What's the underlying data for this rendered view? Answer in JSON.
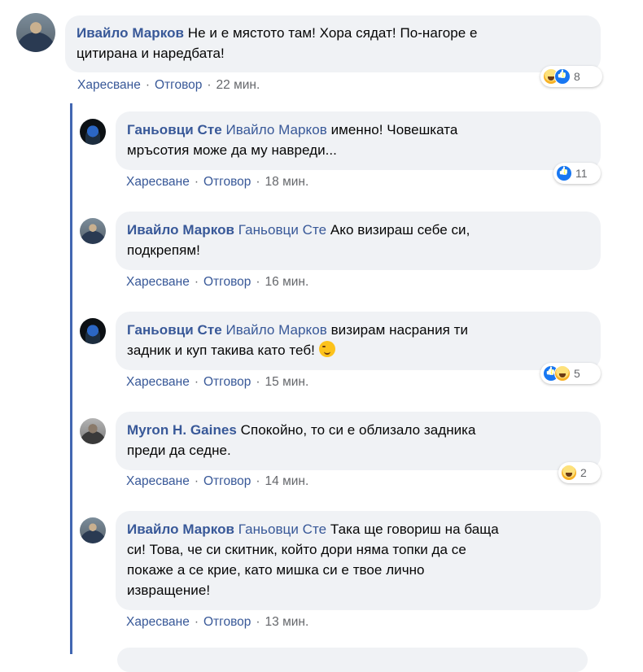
{
  "actions": {
    "like": "Харесване",
    "reply": "Отговор"
  },
  "comments": [
    {
      "author": "Ивайло Марков",
      "mention": "",
      "line1": "Не и е мястото там! Хора сядат! По-нагоре е",
      "line2": "цитирана и наредбата!",
      "time": "22 мин.",
      "reactions": [
        "haha-icon",
        "like-icon"
      ],
      "reaction_count": "8"
    },
    {
      "author": "Ганьовци Сте",
      "mention": "Ивайло Марков",
      "line1": "именно! Човешката",
      "line2": "мръсотия може да му навреди...",
      "time": "18 мин.",
      "reactions": [
        "like-icon"
      ],
      "reaction_count": "11"
    },
    {
      "author": "Ивайло Марков",
      "mention": "Ганьовци Сте",
      "line1": "Ако визираш себе си,",
      "line2": "подкрепям!",
      "time": "16 мин."
    },
    {
      "author": "Ганьовци Сте",
      "mention": "Ивайло Марков",
      "line1": "визирам насрания ти",
      "line2": "задник и куп такива като теб!",
      "emoji": "winking-face-icon",
      "time": "15 мин.",
      "reactions": [
        "like-icon",
        "haha-icon"
      ],
      "reaction_count": "5"
    },
    {
      "author": "Myron H. Gaines",
      "mention": "",
      "line1": "Спокойно, то си е облизало задника",
      "line2": "преди да седне.",
      "time": "14 мин.",
      "reactions": [
        "haha-icon"
      ],
      "reaction_count": "2"
    },
    {
      "author": "Ивайло Марков",
      "mention": "Ганьовци Сте",
      "line1": "Така ще говориш на баща",
      "line2": "си! Това, че си скитник, който дори няма топки да се",
      "line3": "покаже а се крие, като мишка си е твое лично",
      "line4": "извращение!",
      "time": "13 мин."
    }
  ]
}
